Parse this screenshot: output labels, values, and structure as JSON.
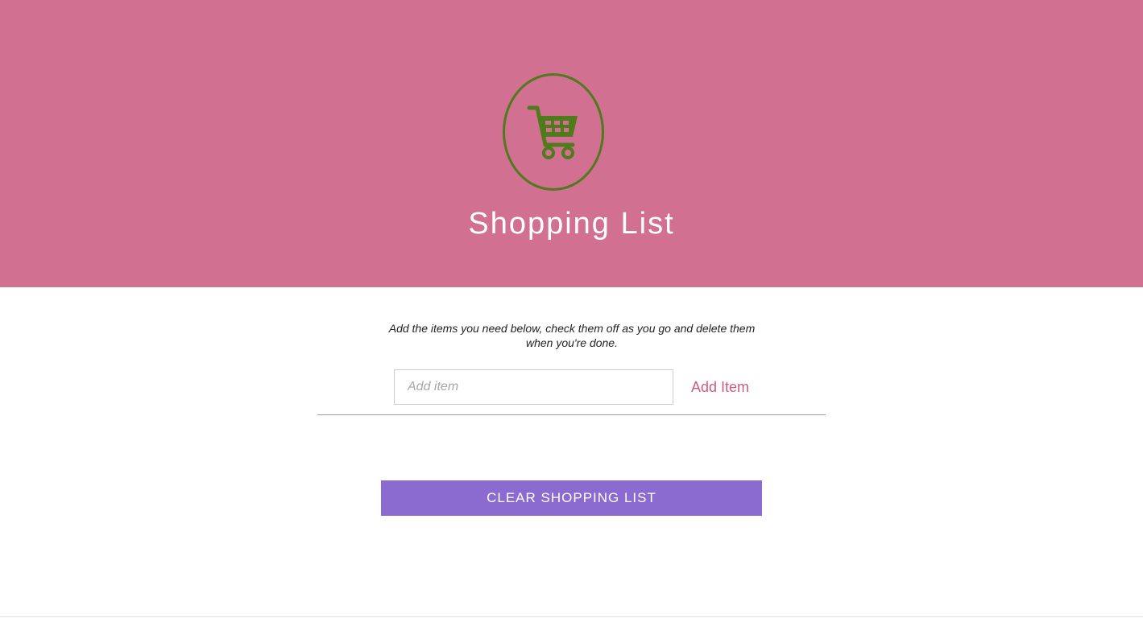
{
  "header": {
    "title": "Shopping List",
    "logo_icon": "shopping-cart-icon",
    "background_color": "#d17090",
    "icon_color": "#4f7b1c"
  },
  "main": {
    "instructions": "Add the items you need below, check them off as you go and delete them when you're done.",
    "item_input": {
      "placeholder": "Add item",
      "value": ""
    },
    "add_button_label": "Add Item",
    "clear_button_label": "CLEAR SHOPPING LIST",
    "clear_button_color": "#8c6bd0",
    "add_button_color": "#d05a86"
  }
}
